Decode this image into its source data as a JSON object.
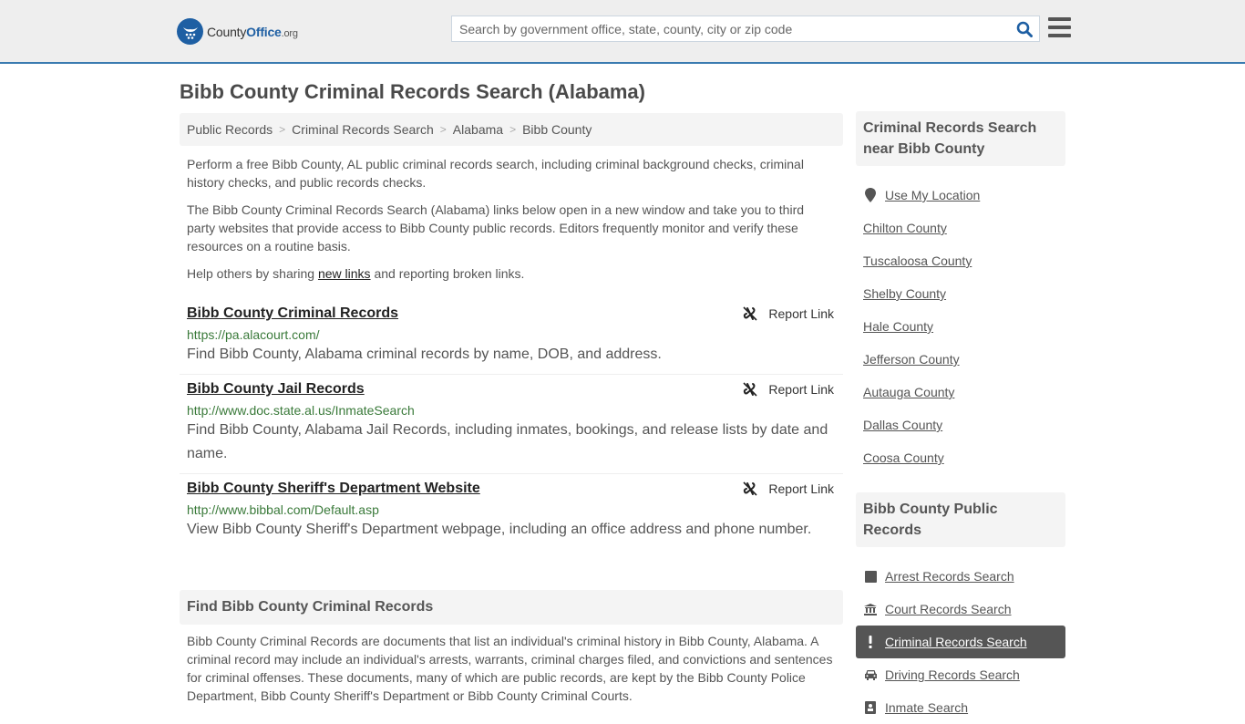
{
  "header": {
    "logo_text_prefix": "County",
    "logo_text_brand": "Office",
    "logo_text_tld": ".org",
    "search_placeholder": "Search by government office, state, county, city or zip code",
    "search_value": "",
    "colors": {
      "brand": "#1e5fa3",
      "accent_border": "#3a7bb0"
    }
  },
  "page": {
    "title": "Bibb County Criminal Records Search (Alabama)"
  },
  "breadcrumb": [
    {
      "label": "Public Records"
    },
    {
      "label": "Criminal Records Search"
    },
    {
      "label": "Alabama"
    },
    {
      "label": "Bibb County"
    }
  ],
  "breadcrumb_separator": ">",
  "intro": {
    "p1": "Perform a free Bibb County, AL public criminal records search, including criminal background checks, criminal history checks, and public records checks.",
    "p2": "The Bibb County Criminal Records Search (Alabama) links below open in a new window and take you to third party websites that provide access to Bibb County public records. Editors frequently monitor and verify these resources on a routine basis.",
    "p3_before": "Help others by sharing ",
    "p3_link": "new links",
    "p3_after": " and reporting broken links."
  },
  "results": [
    {
      "title": "Bibb County Criminal Records",
      "url": "https://pa.alacourt.com/",
      "description": "Find Bibb County, Alabama criminal records by name, DOB, and address.",
      "report_label": "Report Link"
    },
    {
      "title": "Bibb County Jail Records",
      "url": "http://www.doc.state.al.us/InmateSearch",
      "description": "Find Bibb County, Alabama Jail Records, including inmates, bookings, and release lists by date and name.",
      "report_label": "Report Link"
    },
    {
      "title": "Bibb County Sheriff's Department Website",
      "url": "http://www.bibbal.com/Default.asp",
      "description": "View Bibb County Sheriff's Department webpage, including an office address and phone number.",
      "report_label": "Report Link"
    }
  ],
  "find_section": {
    "heading": "Find Bibb County Criminal Records",
    "body": "Bibb County Criminal Records are documents that list an individual's criminal history in Bibb County, Alabama. A criminal record may include an individual's arrests, warrants, criminal charges filed, and convictions and sentences for criminal offenses. These documents, many of which are public records, are kept by the Bibb County Police Department, Bibb County Sheriff's Department or Bibb County Criminal Courts."
  },
  "sidebar": {
    "nearby": {
      "heading": "Criminal Records Search near Bibb County",
      "use_location": {
        "label": "Use My Location",
        "icon": "map-marker-icon"
      },
      "items": [
        {
          "label": "Chilton County"
        },
        {
          "label": "Tuscaloosa County"
        },
        {
          "label": "Shelby County"
        },
        {
          "label": "Hale County"
        },
        {
          "label": "Jefferson County"
        },
        {
          "label": "Autauga County"
        },
        {
          "label": "Dallas County"
        },
        {
          "label": "Coosa County"
        }
      ]
    },
    "public_records": {
      "heading": "Bibb County Public Records",
      "items": [
        {
          "label": "Arrest Records Search",
          "icon": "square-icon",
          "active": false
        },
        {
          "label": "Court Records Search",
          "icon": "courthouse-icon",
          "active": false
        },
        {
          "label": "Criminal Records Search",
          "icon": "exclamation-icon",
          "active": true
        },
        {
          "label": "Driving Records Search",
          "icon": "car-icon",
          "active": false
        },
        {
          "label": "Inmate Search",
          "icon": "inmate-icon",
          "active": false
        }
      ]
    }
  }
}
